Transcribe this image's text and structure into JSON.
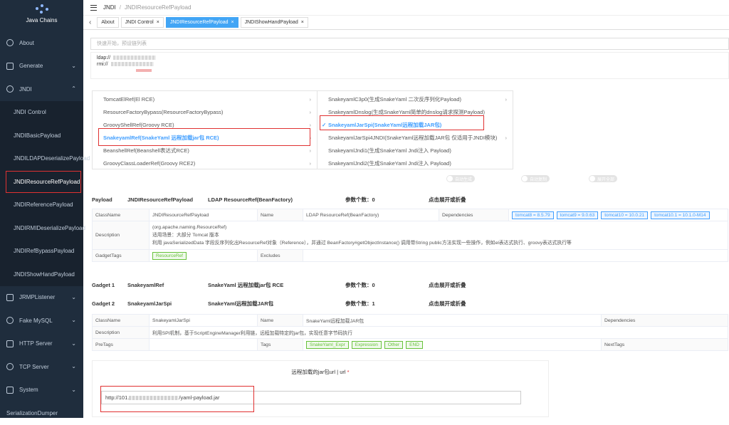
{
  "app": {
    "name": "Java Chains"
  },
  "sidebar": {
    "items": [
      {
        "label": "About",
        "icon": "info-icon"
      },
      {
        "label": "Generate",
        "icon": "generate-icon",
        "arrow": "⌄"
      },
      {
        "label": "JNDI",
        "icon": "jndi-icon",
        "arrow": "⌃"
      },
      {
        "label": "JNDI Control"
      },
      {
        "label": "JNDIBasicPayload"
      },
      {
        "label": "JNDILDAPDeserializePayload"
      },
      {
        "label": "JNDIResourceRefPayload"
      },
      {
        "label": "JNDIReferencePayload"
      },
      {
        "label": "JNDIRMIDeserializePayload"
      },
      {
        "label": "JNDIRefBypassPayload"
      },
      {
        "label": "JNDIShowHandPayload"
      },
      {
        "label": "JRMPListener",
        "icon": "jrmp-icon",
        "arrow": "⌄"
      },
      {
        "label": "Fake MySQL",
        "icon": "mysql-icon",
        "arrow": "⌄"
      },
      {
        "label": "HTTP Server",
        "icon": "http-icon",
        "arrow": "⌄"
      },
      {
        "label": "TCP Server",
        "icon": "tcp-icon",
        "arrow": "⌄"
      },
      {
        "label": "System",
        "icon": "gear-icon",
        "arrow": "⌄"
      },
      {
        "label": "SerializationDumper"
      }
    ]
  },
  "header": {
    "crumb1": "JNDI",
    "sep": "/",
    "crumb2": "JNDIResourceRefPayload"
  },
  "tabs": [
    {
      "label": "About"
    },
    {
      "label": "JNDI Control",
      "close": "×"
    },
    {
      "label": "JNDIResourceRefPayload",
      "close": "×"
    },
    {
      "label": "JNDIShowHandPayload",
      "close": "×"
    }
  ],
  "search": {
    "placeholder": "快速开始，预设链列表"
  },
  "urls": {
    "ldap": "ldap://",
    "rmi": "rmi://"
  },
  "cascader": {
    "col1": [
      {
        "label": "TomcatElRef(El RCE)"
      },
      {
        "label": "ResourceFactoryBypass(ResourceFactoryBypass)"
      },
      {
        "label": "GroovyShellRef(Groovy RCE)"
      },
      {
        "label": "SnakeyamlRef(SnakeYaml 远程加载jar包 RCE)"
      },
      {
        "label": "BeanshellRef(Beanshell表达式RCE)"
      },
      {
        "label": "GroovyClassLoaderRef(Groovy RCE2)"
      }
    ],
    "col2": [
      {
        "label": "SnakeyamlC3p0(生成SnakeYaml 二次反序列化Payload)"
      },
      {
        "label": "SnakeyamlDnslog(生成SnakeYaml简单的dnslog请求探测Payload)"
      },
      {
        "label": "SnakeyamlJarSpi(SnakeYaml远程加载JAR包)",
        "check": "✓"
      },
      {
        "label": "SnakeyamlJarSpi4JNDI(SnakeYaml远程加载JAR包 仅适用于JNDI模块)"
      },
      {
        "label": "SnakeyamlJndi1(生成SnakeYaml Jndi注入 Payload)"
      },
      {
        "label": "SnakeyamlJndi2(生成SnakeYaml Jndi注入 Payload)"
      }
    ],
    "chev": "›"
  },
  "toggles": [
    {
      "label": "自动生成"
    },
    {
      "label": "自动复制"
    },
    {
      "label": "展开全部"
    }
  ],
  "payload": {
    "title": "Payload",
    "name": "JNDIResourceRefPayload",
    "desc": "LDAP ResourceRef(BeanFactory)",
    "params": "参数个数：0",
    "fold": "点击展开或折叠",
    "table": {
      "k_classname": "ClassName",
      "v_classname": "JNDIResourceRefPayload",
      "k_name": "Name",
      "v_name": "LDAP ResourceRef(BeanFactory)",
      "k_deps": "Dependencies",
      "deps": [
        "tomcat8 = 8.5.79",
        "tomcat9 = 9.0.63",
        "tomcat10 = 10.0.21",
        "tomcat10.1 = 10.1.0-M14"
      ],
      "k_desc": "Description",
      "desc1": "(org.apache.naming.ResourceRef)",
      "desc2": "适用场景：大部分 Tomcat 版本",
      "desc3": "利用 javaSerializedData 字段反序列化出ResourceRef对象（Reference），并通过 BeanFactory#getObjectInstance() 调用带String public方法实现一些操作，例如el表达式执行、groovy表达式执行等",
      "k_gadgettags": "GadgetTags",
      "gadgettag": "ResourceRef",
      "k_excludes": "Excludes"
    }
  },
  "gadget1": {
    "title": "Gadget 1",
    "name": "SnakeyamlRef",
    "desc": "SnakeYaml 远程加载jar包 RCE",
    "params": "参数个数：0",
    "fold": "点击展开或折叠"
  },
  "gadget2": {
    "title": "Gadget 2",
    "name": "SnakeyamlJarSpi",
    "desc": "SnakeYaml远程加载JAR包",
    "params": "参数个数：1",
    "fold": "点击展开或折叠",
    "table": {
      "k_classname": "ClassName",
      "v_classname": "SnakeyamlJarSpi",
      "k_name": "Name",
      "v_name": "SnakeYaml远程加载JAR包",
      "k_deps": "Dependencies",
      "k_desc": "Description",
      "v_desc": "利用SPI机制，基于ScriptEngineManager利用链，远程加载特定的jar包，实现任意字节码执行",
      "k_pretags": "PreTags",
      "k_tags": "Tags",
      "tags": [
        "SnakeYaml_Expr",
        "Expression",
        "Other",
        "END"
      ],
      "k_nexttags": "NextTags"
    }
  },
  "form": {
    "label": "远程加载的jar包url | url",
    "req": "*",
    "value_prefix": "http://101.",
    "value_suffix": "/yaml-payload.jar"
  }
}
